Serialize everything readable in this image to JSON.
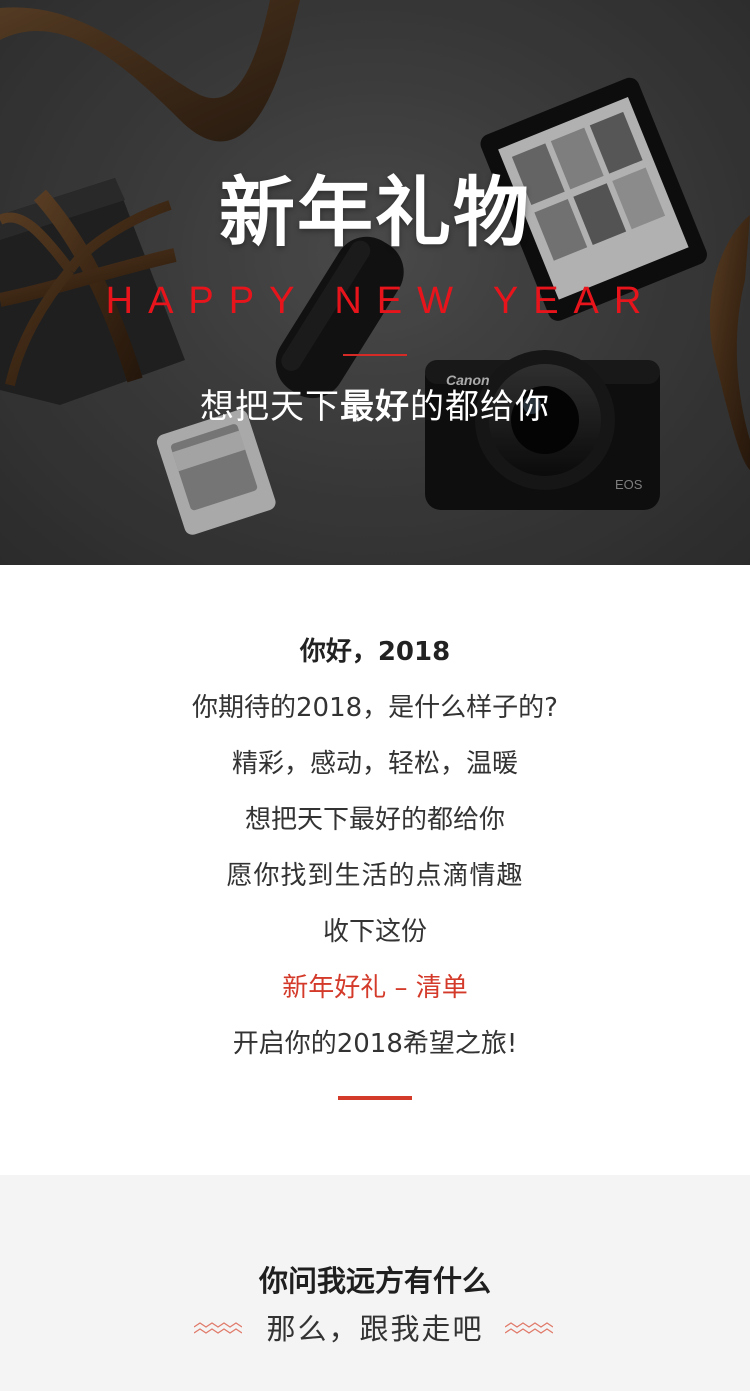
{
  "hero": {
    "title": "新年礼物",
    "subtitle": "HAPPY NEW YEAR",
    "tagline_pre": "想把天下",
    "tagline_bold": "最好",
    "tagline_post": "的都给你",
    "camera_brand": "Canon",
    "camera_model": "EOS",
    "colors": {
      "subtitle": "#e8141c",
      "rule": "#d52a26"
    }
  },
  "intro": {
    "lines": [
      "你好，2018",
      "你期待的2018，是什么样子的?",
      "精彩，感动，轻松，温暖",
      "想把天下最好的都给你",
      "愿你找到生活的点滴情趣",
      "收下这份",
      "新年好礼 – 清单",
      "开启你的2018希望之旅!"
    ],
    "colors": {
      "accent": "#d43a2a"
    }
  },
  "section": {
    "heading": "你问我远方有什么",
    "subheading": "那么，跟我走吧"
  }
}
